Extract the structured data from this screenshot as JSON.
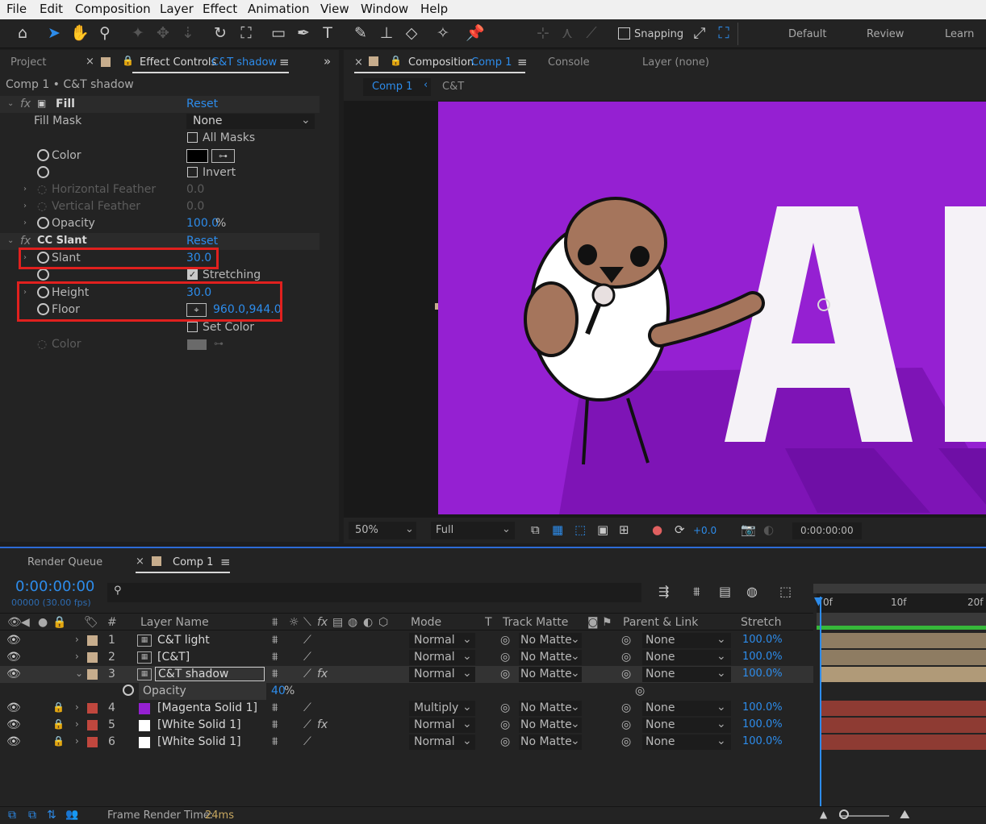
{
  "menu": [
    "File",
    "Edit",
    "Composition",
    "Layer",
    "Effect",
    "Animation",
    "View",
    "Window",
    "Help"
  ],
  "toolbar": {
    "snapping_label": "Snapping",
    "workspaces": [
      "Default",
      "Review",
      "Learn"
    ]
  },
  "effect_panel": {
    "tab_project": "Project",
    "tab_effect_controls": "Effect Controls",
    "tab_layer_name": "C&T shadow",
    "breadcrumb": "Comp 1 • C&T shadow",
    "fill": {
      "name": "Fill",
      "reset": "Reset",
      "fill_mask_label": "Fill Mask",
      "fill_mask_value": "None",
      "all_masks_label": "All Masks",
      "color_label": "Color",
      "invert_label": "Invert",
      "h_feather_label": "Horizontal Feather",
      "h_feather_value": "0.0",
      "v_feather_label": "Vertical Feather",
      "v_feather_value": "0.0",
      "opacity_label": "Opacity",
      "opacity_value": "100.0",
      "opacity_unit": "%"
    },
    "slant": {
      "name": "CC Slant",
      "reset": "Reset",
      "slant_label": "Slant",
      "slant_value": "30.0",
      "stretching_label": "Stretching",
      "height_label": "Height",
      "height_value": "30.0",
      "floor_label": "Floor",
      "floor_value": "960.0,944.0",
      "set_color_label": "Set Color",
      "color_label": "Color"
    }
  },
  "comp_panel": {
    "tab_composition": "Composition",
    "tab_comp_name": "Comp 1",
    "tab_console": "Console",
    "tab_layer": "Layer (none)",
    "nav_comp1": "Comp 1",
    "nav_ct": "C&T",
    "canvas_text": "AI",
    "zoom": "50%",
    "resolution": "Full",
    "exposure": "+0.0",
    "timecode": "0:00:00:00",
    "bg_color": "#9520d2"
  },
  "timeline": {
    "tab_render_queue": "Render Queue",
    "tab_comp": "Comp 1",
    "timecode": "0:00:00:00",
    "frames_fps": "00000 (30.00 fps)",
    "ruler": [
      "0f",
      "10f",
      "20f"
    ],
    "columns": {
      "hash": "#",
      "layer_name": "Layer Name",
      "mode": "Mode",
      "t": "T",
      "track_matte": "Track Matte",
      "parent": "Parent & Link",
      "stretch": "Stretch"
    },
    "layers": [
      {
        "num": "1",
        "name": "C&T light",
        "mode": "Normal",
        "matte": "No Matte",
        "parent": "None",
        "stretch": "100.0%",
        "color": "#c7ad8d"
      },
      {
        "num": "2",
        "name": "[C&T]",
        "mode": "Normal",
        "matte": "No Matte",
        "parent": "None",
        "stretch": "100.0%",
        "color": "#c7ad8d"
      },
      {
        "num": "3",
        "name": "C&T shadow",
        "mode": "Normal",
        "matte": "No Matte",
        "parent": "None",
        "stretch": "100.0%",
        "color": "#c7ad8d"
      },
      {
        "num": "4",
        "name": "[Magenta Solid 1]",
        "mode": "Multiply",
        "matte": "No Matte",
        "parent": "None",
        "stretch": "100.0%",
        "color": "#c0473e"
      },
      {
        "num": "5",
        "name": "[White Solid 1]",
        "mode": "Normal",
        "matte": "No Matte",
        "parent": "None",
        "stretch": "100.0%",
        "color": "#c0473e"
      },
      {
        "num": "6",
        "name": "[White Solid 1]",
        "mode": "Normal",
        "matte": "No Matte",
        "parent": "None",
        "stretch": "100.0%",
        "color": "#c0473e"
      }
    ],
    "opacity_label": "Opacity",
    "opacity_value": "40",
    "opacity_unit": "%",
    "frame_render_label": "Frame Render Time:",
    "frame_render_value": "24ms"
  }
}
